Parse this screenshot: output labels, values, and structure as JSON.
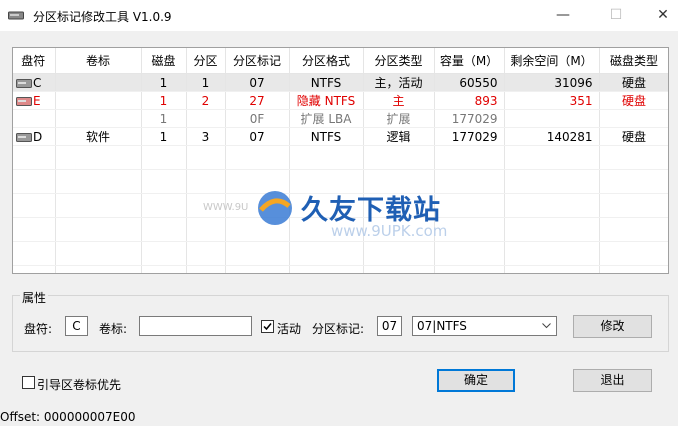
{
  "window": {
    "title": "分区标记修改工具 V1.0.9",
    "min_glyph": "—",
    "max_glyph": "☐",
    "close_glyph": "✕"
  },
  "table": {
    "headers": [
      "盘符",
      "卷标",
      "磁盘",
      "分区",
      "分区标记",
      "分区格式",
      "分区类型",
      "容量（M）",
      "剩余空间（M）",
      "磁盘类型"
    ],
    "rows": [
      {
        "icon": "drive",
        "letter": "C",
        "label": "",
        "disk": "1",
        "part": "1",
        "flag": "07",
        "format": "NTFS",
        "type": "主，活动",
        "cap": "60550",
        "free": "31096",
        "dtype": "硬盘",
        "style": "sel"
      },
      {
        "icon": "drive-red",
        "letter": "E",
        "label": "",
        "disk": "1",
        "part": "2",
        "flag": "27",
        "format": "隐藏 NTFS",
        "type": "主",
        "cap": "893",
        "free": "351",
        "dtype": "硬盘",
        "style": "red"
      },
      {
        "icon": "",
        "letter": "",
        "label": "",
        "disk": "1",
        "part": "",
        "flag": "0F",
        "format": "扩展 LBA",
        "type": "扩展",
        "cap": "177029",
        "free": "",
        "dtype": "",
        "style": "gray"
      },
      {
        "icon": "drive",
        "letter": "D",
        "label": "软件",
        "disk": "1",
        "part": "3",
        "flag": "07",
        "format": "NTFS",
        "type": "逻辑",
        "cap": "177029",
        "free": "140281",
        "dtype": "硬盘",
        "style": ""
      }
    ]
  },
  "watermark": {
    "brand": "久友下载站",
    "url": "www.9UPK.com",
    "left_text": "WWW.9U"
  },
  "properties": {
    "legend": "属性",
    "drive_label": "盘符:",
    "drive_value": "C",
    "volume_label": "卷标:",
    "volume_value": "",
    "active_label": "活动",
    "active_checked": true,
    "flag_label": "分区标记:",
    "flag_value": "07",
    "select_value": "07|NTFS",
    "modify_button": "修改"
  },
  "boot_priority_label": "引导区卷标优先",
  "boot_priority_checked": false,
  "ok_button": "确定",
  "exit_button": "退出",
  "status": "Offset: 000000007E00",
  "colors": {
    "red": "#e00000",
    "accent": "#0078d7"
  }
}
